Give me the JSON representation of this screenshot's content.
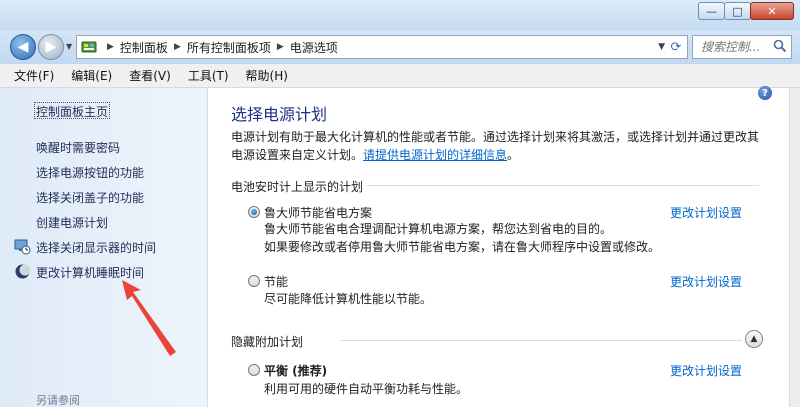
{
  "window": {
    "buttons": {
      "minimize": "—",
      "maximize": "□",
      "close": "✕"
    }
  },
  "address": {
    "crumbs": [
      "控制面板",
      "所有控制面板项",
      "电源选项"
    ],
    "search_placeholder": "搜索控制..."
  },
  "menu": [
    "文件(F)",
    "编辑(E)",
    "查看(V)",
    "工具(T)",
    "帮助(H)"
  ],
  "sidebar": {
    "home": "控制面板主页",
    "items": [
      "唤醒时需要密码",
      "选择电源按钮的功能",
      "选择关闭盖子的功能",
      "创建电源计划",
      "选择关闭显示器的时间",
      "更改计算机睡眠时间"
    ],
    "see_also": "另请参阅"
  },
  "main": {
    "title": "选择电源计划",
    "desc_line1": "电源计划有助于最大化计算机的性能或者节能。通过选择计划来将其激活，或选择计划并通过更改其",
    "desc_line2_prefix": "电源设置来自定义计划。",
    "desc_link": "请提供电源计划的详细信息",
    "desc_suffix": "。",
    "battery_section": "电池安时计上显示的计划",
    "hidden_section": "隐藏附加计划",
    "change_link": "更改计划设置",
    "plans": [
      {
        "name": "鲁大师节能省电方案",
        "selected": true,
        "desc": [
          "鲁大师节能省电合理调配计算机电源方案，帮您达到省电的目的。",
          "如果要修改或者停用鲁大师节能省电方案，请在鲁大师程序中设置或修改。"
        ]
      },
      {
        "name": "节能",
        "selected": false,
        "desc": [
          "尽可能降低计算机性能以节能。"
        ]
      },
      {
        "name": "平衡 (推荐)",
        "selected": false,
        "desc": [
          "利用可用的硬件自动平衡功耗与性能。"
        ]
      }
    ]
  },
  "colors": {
    "link": "#0066cc",
    "title": "#1e3287",
    "annotation_arrow": "#e8443a"
  }
}
